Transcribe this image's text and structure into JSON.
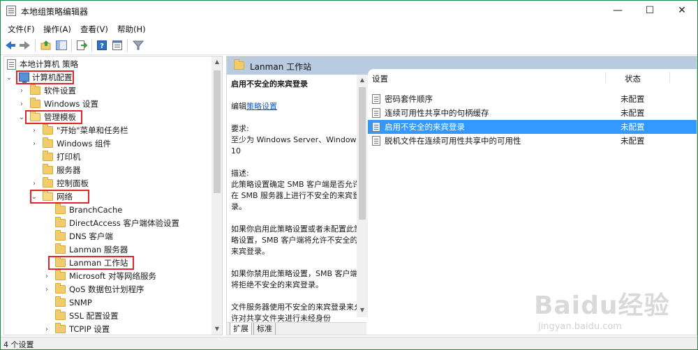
{
  "window": {
    "title": "本地组策略编辑器",
    "controls": {
      "minimize": "—",
      "maximize": "☐",
      "close": "✕"
    }
  },
  "menu": [
    "文件(F)",
    "操作(A)",
    "查看(V)",
    "帮助(H)"
  ],
  "toolbar": {
    "icons": [
      "back-arrow-icon",
      "forward-arrow-icon",
      "up-folder-icon",
      "show-hide-tree-icon",
      "export-list-icon",
      "help-icon",
      "properties-icon",
      "filter-icon"
    ]
  },
  "tree": {
    "root": "本地计算机 策略",
    "computer_config": "计算机配置",
    "software_settings": "软件设置",
    "windows_settings": "Windows 设置",
    "admin_templates": "管理模板",
    "start_menu": "\"开始\"菜单和任务栏",
    "windows_components": "Windows 组件",
    "printers": "打印机",
    "server": "服务器",
    "control_panel": "控制面板",
    "network": "网络",
    "network_children": [
      "BranchCache",
      "DirectAccess 客户端体验设置",
      "DNS 客户端",
      "Lanman 服务器",
      "Lanman 工作站",
      "Microsoft 对等网络服务",
      "QoS 数据包计划程序",
      "SNMP",
      "SSL 配置设置",
      "TCPIP 设置"
    ]
  },
  "right": {
    "header": "Lanman 工作站",
    "desc_title": "启用不安全的来宾登录",
    "edit_prefix": "编辑",
    "edit_link": "策略设置",
    "requirement_label": "要求:",
    "requirement_text": "至少为 Windows Server、Windows 10",
    "description_label": "描述:",
    "description_p1": "此策略设置确定 SMB 客户端是否允许在 SMB 服务器上进行不安全的来宾登录。",
    "description_p2": "如果你启用此策略设置或者未配置此策略设置，SMB 客户端将允许不安全的来宾登录。",
    "description_p3": "如果你禁用此策略设置，SMB 客户端将拒绝不安全的来宾登录。",
    "description_p4": "文件服务器使用不安全的来宾登录来允许对共享文件夹进行未经身份",
    "col_setting": "设置",
    "col_state": "状态",
    "rows": [
      {
        "name": "密码套件顺序",
        "state": "未配置"
      },
      {
        "name": "连续可用性共享中的句柄缓存",
        "state": "未配置"
      },
      {
        "name": "启用不安全的来宾登录",
        "state": "未配置"
      },
      {
        "name": "脱机文件在连续可用性共享中的可用性",
        "state": "未配置"
      }
    ],
    "tabs": [
      "扩展",
      "标准"
    ]
  },
  "status": "4 个设置",
  "watermark": {
    "logo": "Baidu经验",
    "sub": "jingyan.baidu.com"
  },
  "colors": {
    "accent_selected": "#3399ff",
    "header_band": "#b8cbe0",
    "highlight_box": "#e0262d",
    "window_border": "#1f8a45"
  }
}
